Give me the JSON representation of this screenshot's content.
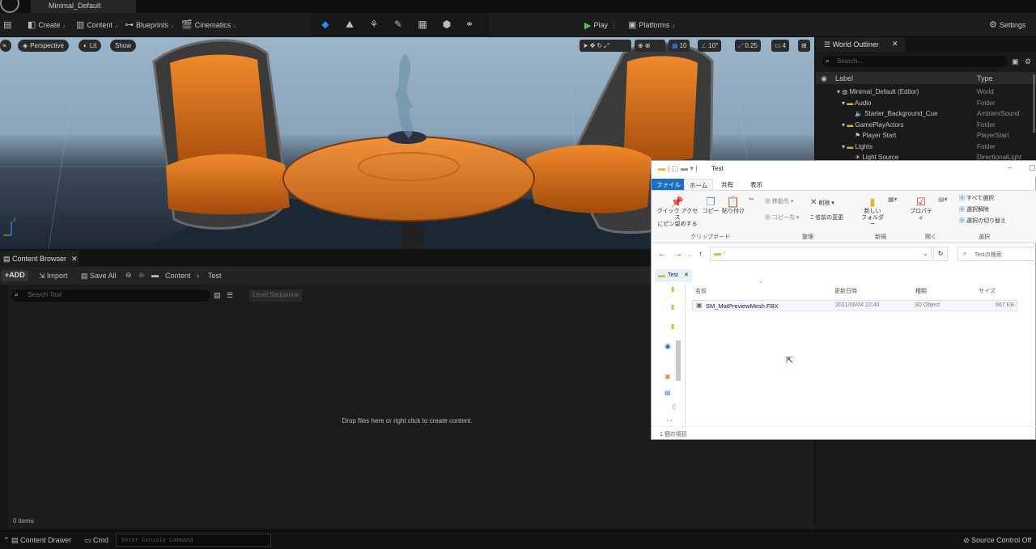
{
  "app": {
    "project_tab": "Minimal_Default"
  },
  "toolbar": {
    "create": "Create",
    "content": "Content",
    "blueprints": "Blueprints",
    "cinematics": "Cinematics",
    "play": "Play",
    "platforms": "Platforms",
    "settings": "Settings"
  },
  "viewport": {
    "perspective": "Perspective",
    "lit": "Lit",
    "show": "Show",
    "grid_snap": "10",
    "rot_snap": "10°",
    "scale_snap": "0.25",
    "camera_speed": "4"
  },
  "outliner": {
    "title": "World Outliner",
    "search_placeholder": "Search...",
    "col_label": "Label",
    "col_type": "Type",
    "rows": [
      {
        "label": "Minimal_Default (Editor)",
        "type": "World"
      },
      {
        "label": "Audio",
        "type": "Folder"
      },
      {
        "label": "Starter_Background_Cue",
        "type": "AmbientSound"
      },
      {
        "label": "GamePlayActors",
        "type": "Folder"
      },
      {
        "label": "Player Start",
        "type": "PlayerStart"
      },
      {
        "label": "Lights",
        "type": "Folder"
      },
      {
        "label": "Light Source",
        "type": "DirectionalLight"
      }
    ]
  },
  "content_browser": {
    "tab": "Content Browser",
    "add": "ADD",
    "import": "Import",
    "save_all": "Save All",
    "crumb_root": "Content",
    "crumb_current": "Test",
    "search_placeholder": "Search Test",
    "level_sequence": "Level Sequence",
    "empty_message": "Drop files here or right click to create content.",
    "item_count": "0 items"
  },
  "statusbar": {
    "content_drawer": "Content Drawer",
    "cmd": "Cmd",
    "console_placeholder": "Enter Console Command",
    "source_control": "Source Control Off"
  },
  "explorer": {
    "title": "Test",
    "tabs": [
      "ファイル",
      "ホーム",
      "共有",
      "表示"
    ],
    "ribbon": {
      "pin": "クイック アクセス\nにピン留めする",
      "copy": "コピー",
      "paste": "貼り付け",
      "move_to": "移動先",
      "copy_to": "コピー先",
      "delete": "削除",
      "rename": "名前の変更",
      "new_folder": "新しい\nフォルダー",
      "properties": "プロパティ",
      "select_all": "すべて選択",
      "select_none": "選択解除",
      "invert_selection": "選択の切り替え",
      "grp_clipboard": "クリップボード",
      "grp_organize": "整理",
      "grp_new": "新規",
      "grp_open": "開く",
      "grp_select": "選択"
    },
    "search_placeholder": "Testの検索",
    "nav_item": "Test",
    "columns": [
      "名前",
      "更新日時",
      "種類",
      "サイズ"
    ],
    "files": [
      {
        "name": "SM_MatPreviewMesh.FBX",
        "date": "2021/06/04 22:40",
        "type": "3D Object",
        "size": "667 KB"
      }
    ],
    "status": "1 個の項目"
  }
}
